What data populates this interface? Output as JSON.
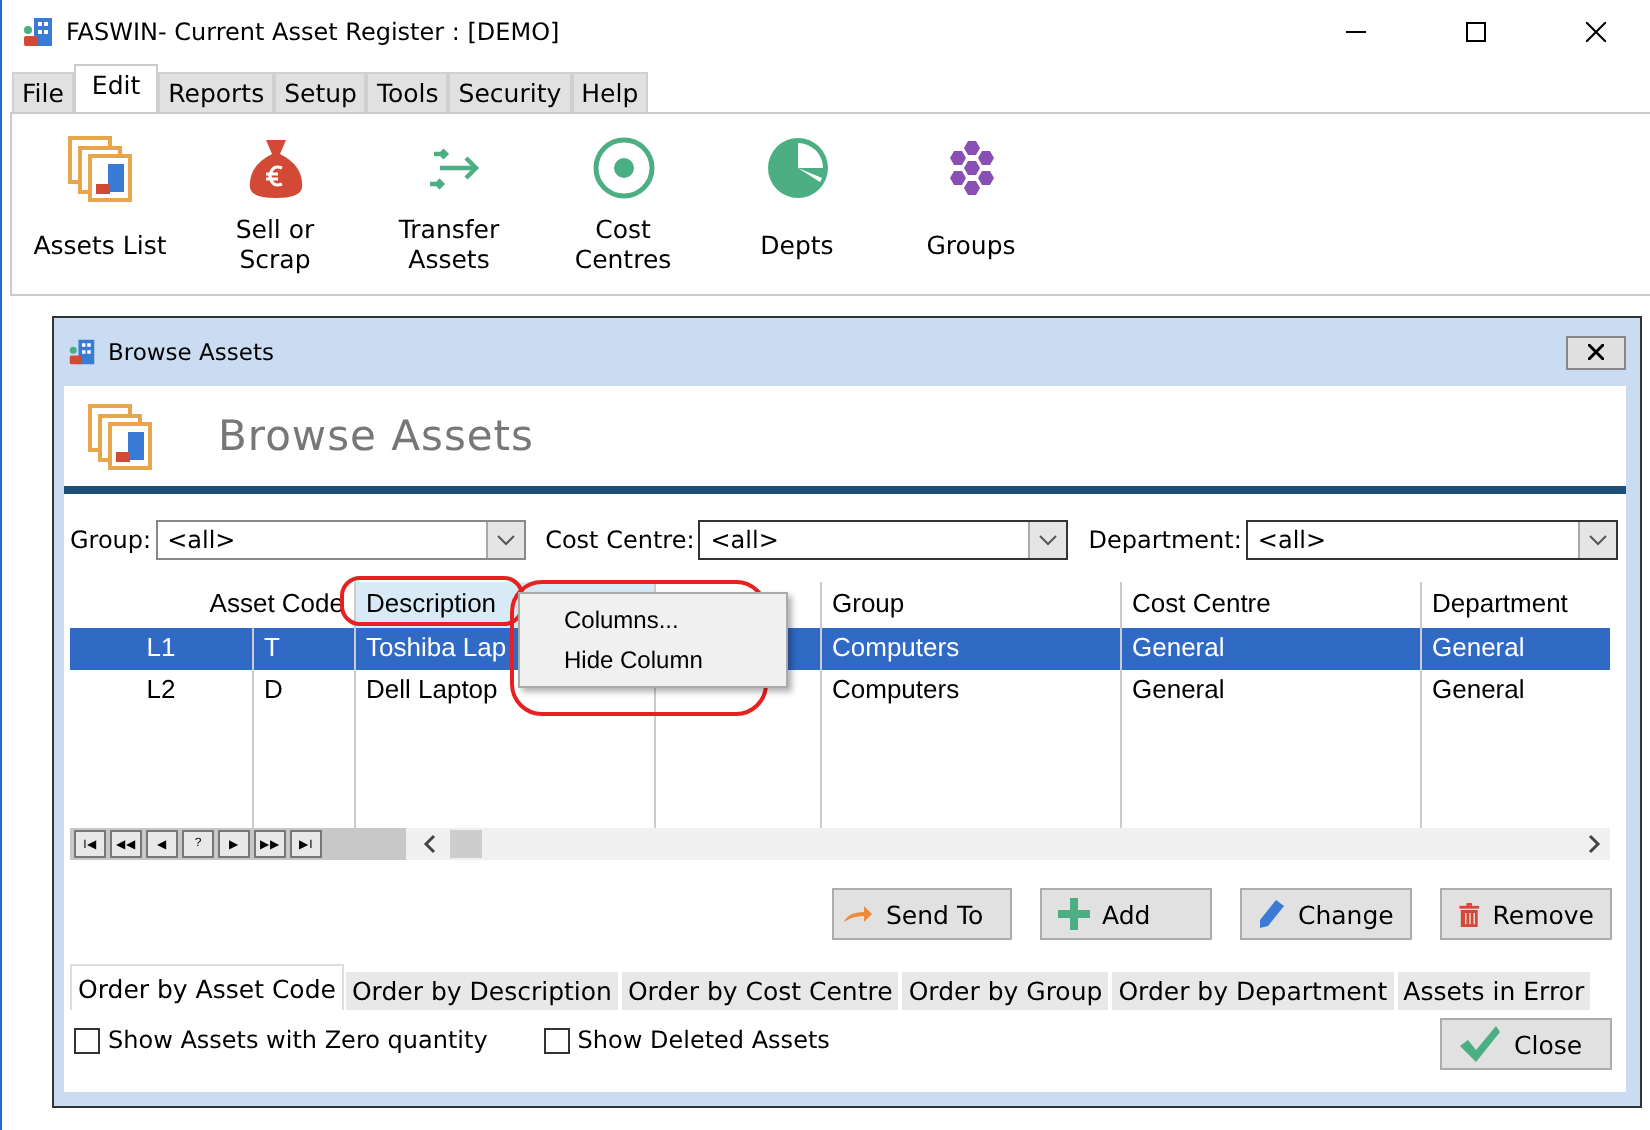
{
  "window": {
    "title": "FASWIN- Current Asset Register : [DEMO]"
  },
  "menu_tabs": [
    {
      "label": "File",
      "selected": false
    },
    {
      "label": "Edit",
      "selected": true
    },
    {
      "label": "Reports",
      "selected": false
    },
    {
      "label": "Setup",
      "selected": false
    },
    {
      "label": "Tools",
      "selected": false
    },
    {
      "label": "Security",
      "selected": false
    },
    {
      "label": "Help",
      "selected": false
    }
  ],
  "ribbon": [
    {
      "kind": "list",
      "label": "Assets List"
    },
    {
      "kind": "sell",
      "label": "Sell or Scrap"
    },
    {
      "kind": "transfer",
      "label": "Transfer Assets"
    },
    {
      "kind": "cost",
      "label": "Cost Centres"
    },
    {
      "kind": "depts",
      "label": "Depts"
    },
    {
      "kind": "groups",
      "label": "Groups"
    }
  ],
  "dialog": {
    "title": "Browse Assets",
    "heading": "Browse Assets",
    "filters": [
      {
        "label": "Group:",
        "value": "<all>"
      },
      {
        "label": "Cost Centre:",
        "value": "<all>"
      },
      {
        "label": "Department:",
        "value": "<all>"
      }
    ],
    "table": {
      "columns": [
        "",
        "Asset Code",
        "Description",
        "",
        "Group",
        "Cost Centre",
        "Department"
      ],
      "rows": [
        {
          "cells": [
            "L1",
            "T",
            "Toshiba Lap",
            "",
            "Computers",
            "General",
            "General"
          ],
          "selected": true
        },
        {
          "cells": [
            "L2",
            "D",
            "Dell Laptop",
            "",
            "Computers",
            "General",
            "General"
          ],
          "selected": false
        }
      ]
    },
    "navigator": [
      "I◀",
      "◀◀",
      "◀",
      "?",
      "▶",
      "▶▶",
      "▶I"
    ],
    "context_menu": [
      "Columns...",
      "Hide Column"
    ],
    "buttons": [
      {
        "kind": "send",
        "label": "Send To"
      },
      {
        "kind": "add",
        "label": "Add"
      },
      {
        "kind": "change",
        "label": "Change"
      },
      {
        "kind": "remove",
        "label": "Remove"
      }
    ],
    "order_tabs": [
      {
        "label": "Order by Asset Code",
        "selected": true
      },
      {
        "label": "Order by Description",
        "selected": false
      },
      {
        "label": "Order by Cost Centre",
        "selected": false
      },
      {
        "label": "Order by Group",
        "selected": false
      },
      {
        "label": "Order by Department",
        "selected": false
      },
      {
        "label": "Assets in Error",
        "selected": false
      }
    ],
    "checkboxes": [
      {
        "label": "Show Assets with Zero quantity",
        "checked": false
      },
      {
        "label": "Show Deleted Assets",
        "checked": false
      }
    ],
    "close_button": "Close"
  }
}
